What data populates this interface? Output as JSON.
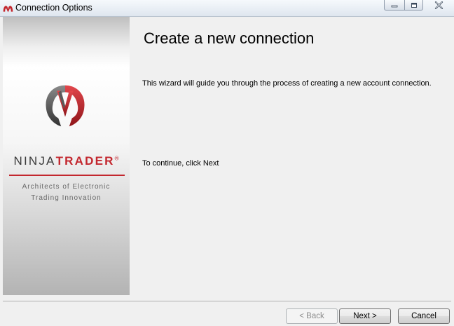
{
  "window": {
    "title": "Connection Options"
  },
  "sidebar": {
    "brand_part1": "NINJA",
    "brand_part2": "TRADER",
    "brand_reg": "®",
    "tagline_line1": "Architects of Electronic",
    "tagline_line2": "Trading Innovation"
  },
  "main": {
    "heading": "Create a new connection",
    "intro": "This wizard will guide you through the process of creating a new account connection.",
    "hint": "To continue, click Next"
  },
  "buttons": {
    "back": "< Back",
    "next": "Next >",
    "cancel": "Cancel"
  },
  "colors": {
    "brand_red": "#c3272e",
    "brand_gray": "#3a3a3a"
  }
}
